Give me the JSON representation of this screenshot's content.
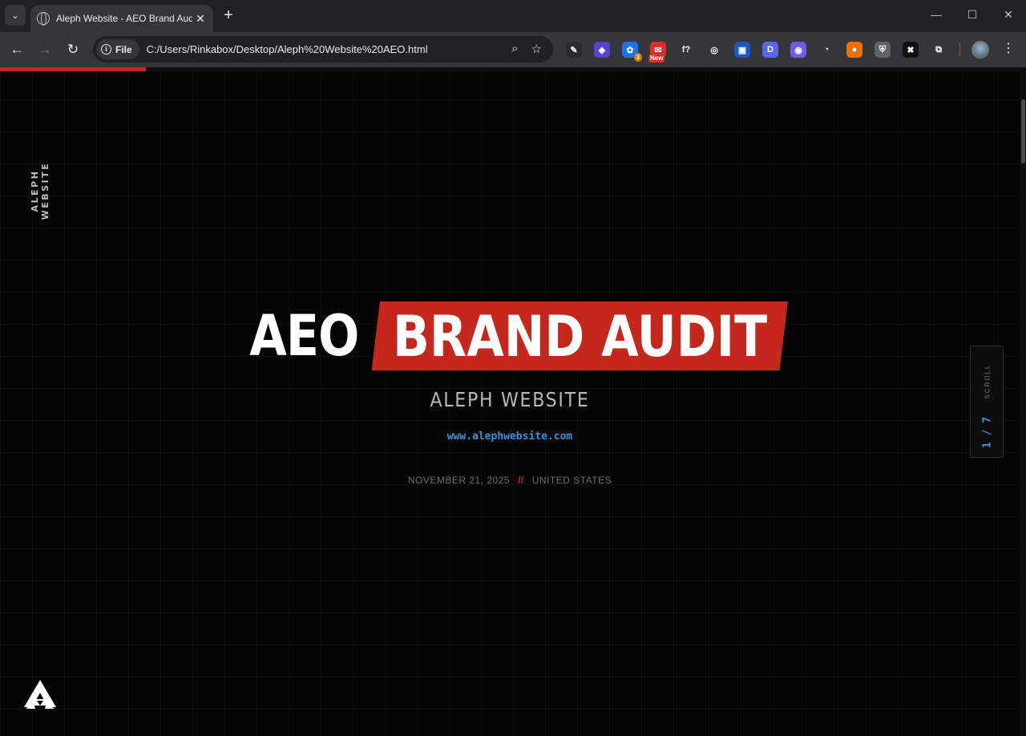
{
  "browser": {
    "tab_title": "Aleph Website - AEO Brand Audit",
    "url_scheme_chip": "File",
    "url": "C:/Users/Rinkabox/Desktop/Aleph%20Website%20AEO.html",
    "extensions": [
      {
        "name": "eyedropper-icon",
        "glyph": "✎",
        "color": "#2b2b2b"
      },
      {
        "name": "layers-icon",
        "glyph": "◆",
        "color": "#5b3fd6"
      },
      {
        "name": "gear-badge-icon",
        "glyph": "✿",
        "color": "#1a73e8",
        "badge": "3"
      },
      {
        "name": "mail-new-icon",
        "glyph": "✉",
        "color": "#d93025",
        "badge_new": "New"
      },
      {
        "name": "font-icon",
        "glyph": "f?",
        "color": "#35363a"
      },
      {
        "name": "glasses-icon",
        "glyph": "◎",
        "color": "#35363a"
      },
      {
        "name": "shield-blue-icon",
        "glyph": "▣",
        "color": "#1a56c4"
      },
      {
        "name": "d-icon",
        "glyph": "D",
        "color": "#5865f2"
      },
      {
        "name": "bot-icon",
        "glyph": "◉",
        "color": "#6c5ce7"
      },
      {
        "name": "search-lens-icon",
        "glyph": "◔",
        "color": "#35363a"
      },
      {
        "name": "fox-icon",
        "glyph": "●",
        "color": "#e8710a"
      },
      {
        "name": "shield-icon",
        "glyph": "⛨",
        "color": "#5f6368"
      },
      {
        "name": "mask-icon",
        "glyph": "✖",
        "color": "#111111"
      },
      {
        "name": "puzzle-icon",
        "glyph": "⧉",
        "color": "#35363a"
      }
    ]
  },
  "page": {
    "side_label": "ALEPH WEBSITE",
    "progress_fraction": 0.143,
    "title_plain": "AEO",
    "title_highlight": "BRAND AUDIT",
    "subtitle": "ALEPH WEBSITE",
    "site_url": "www.alephwebsite.com",
    "date": "NOVEMBER 21, 2025",
    "separator": "//",
    "location": "UNITED STATES",
    "nav_scroll_label": "SCROLL",
    "nav_counter": "1 / 7"
  },
  "colors": {
    "accent_red": "#c4271c",
    "link_blue": "#3a93d6",
    "background": "#050505"
  }
}
